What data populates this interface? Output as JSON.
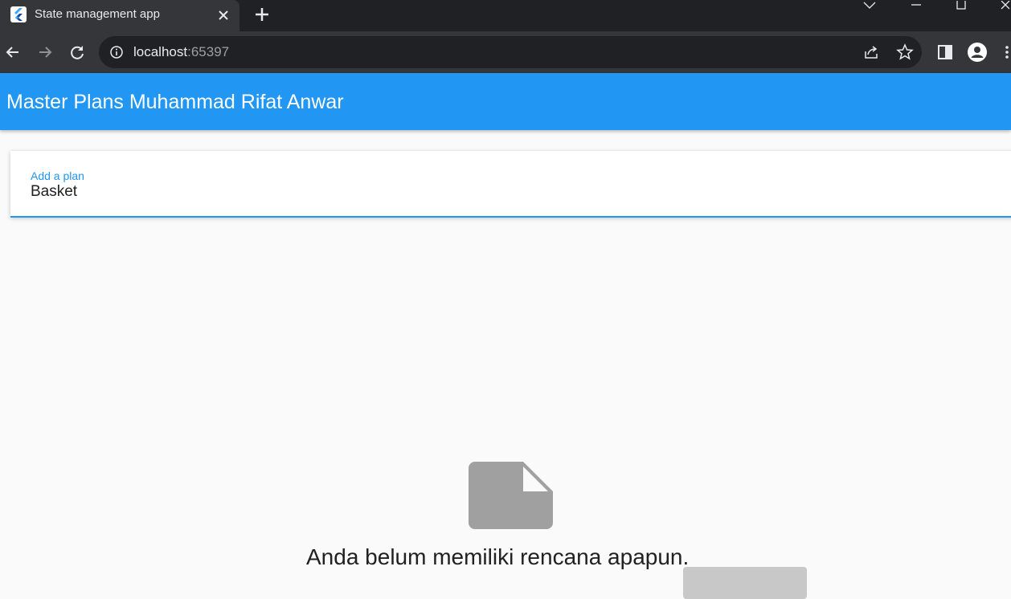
{
  "browser": {
    "tab": {
      "title": "State management app",
      "close_icon": "close-icon",
      "favicon": "flutter-logo-icon"
    },
    "new_tab_icon": "plus-icon",
    "window_controls": [
      "tab-search-icon",
      "minimize-icon",
      "maximize-icon",
      "close-icon"
    ],
    "nav": {
      "back_icon": "arrow-left-icon",
      "forward_icon": "arrow-right-icon",
      "reload_icon": "reload-icon"
    },
    "omnibox": {
      "info_icon": "info-icon",
      "host": "localhost",
      "port": ":65397"
    },
    "toolbar_right": [
      "share-icon",
      "star-icon",
      "side-panel-icon",
      "profile-icon",
      "menu-icon"
    ]
  },
  "app": {
    "title": "Master Plans Muhammad Rifat Anwar",
    "input": {
      "label": "Add a plan",
      "value": "Basket"
    },
    "empty_state": {
      "icon": "note-icon",
      "message": "Anda belum memiliki rencana apapun."
    },
    "colors": {
      "primary": "#2196f3",
      "background": "#fafafa"
    }
  }
}
